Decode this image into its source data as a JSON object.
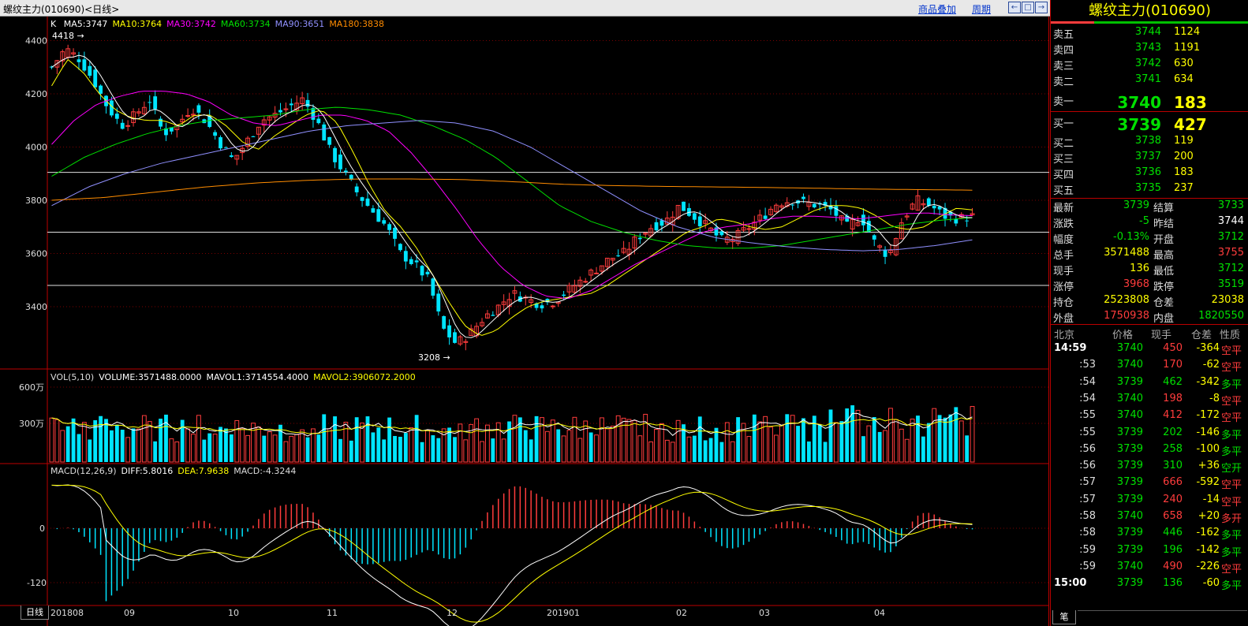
{
  "window": {
    "title": "螺纹主力(010690)<日线>",
    "link_overlay": "商品叠加",
    "link_period": "周期",
    "btn_prev_icon": "arrow-left-icon",
    "btn_restore_icon": "window-restore-icon",
    "btn_next_icon": "arrow-right-icon"
  },
  "main_chart": {
    "label": "K",
    "ma_legend": [
      {
        "text": "MA5:3747",
        "color": "#ffffff"
      },
      {
        "text": "MA10:3764",
        "color": "#ffff00"
      },
      {
        "text": "MA30:3742",
        "color": "#ff00ff"
      },
      {
        "text": "MA60:3734",
        "color": "#00e000"
      },
      {
        "text": "MA90:3651",
        "color": "#9090ff"
      },
      {
        "text": "MA180:3838",
        "color": "#ff8c00"
      }
    ],
    "y_ticks": [
      "4400",
      "4200",
      "4000",
      "3800",
      "3600",
      "3400"
    ],
    "high_marker": "4418",
    "low_marker": "3208"
  },
  "volume_chart": {
    "legend": [
      {
        "text": "VOL(5,10)",
        "color": "#dddddd"
      },
      {
        "text": "VOLUME:3571488.0000",
        "color": "#ffffff"
      },
      {
        "text": "MAVOL1:3714554.4000",
        "color": "#ffffff"
      },
      {
        "text": "MAVOL2:3906072.2000",
        "color": "#ffff00"
      }
    ],
    "y_ticks": [
      "600万",
      "300万"
    ]
  },
  "macd_chart": {
    "legend": [
      {
        "text": "MACD(12,26,9)",
        "color": "#dddddd"
      },
      {
        "text": "DIFF:5.8016",
        "color": "#ffffff"
      },
      {
        "text": "DEA:7.9638",
        "color": "#ffff00"
      },
      {
        "text": "MACD:-4.3244",
        "color": "#dddddd"
      }
    ],
    "y_ticks": [
      "0",
      "-120"
    ]
  },
  "x_axis": {
    "tab": "日线",
    "labels": [
      "201808",
      "09",
      "10",
      "11",
      "12",
      "201901",
      "02",
      "03",
      "04"
    ]
  },
  "chart_data": {
    "type": "candlestick",
    "title": "螺纹主力(010690)<日线>",
    "x_labels": [
      "201808",
      "09",
      "10",
      "11",
      "12",
      "201901",
      "02",
      "03",
      "04"
    ],
    "ylim": [
      3200,
      4450
    ],
    "y_ticks": [
      4400,
      4200,
      4000,
      3800,
      3600,
      3400
    ],
    "period_high": 4418,
    "period_low": 3208,
    "close_path": [
      4300,
      4370,
      4330,
      4250,
      4150,
      4080,
      4120,
      4180,
      4050,
      4080,
      4150,
      4100,
      4020,
      3950,
      4020,
      4100,
      4120,
      4150,
      4180,
      4100,
      3980,
      3900,
      3820,
      3760,
      3700,
      3600,
      3560,
      3500,
      3320,
      3260,
      3300,
      3360,
      3400,
      3450,
      3430,
      3410,
      3420,
      3460,
      3500,
      3540,
      3580,
      3600,
      3660,
      3700,
      3720,
      3780,
      3740,
      3700,
      3650,
      3660,
      3700,
      3740,
      3790,
      3800,
      3790,
      3780,
      3760,
      3700,
      3740,
      3640,
      3590,
      3730,
      3800,
      3780,
      3740,
      3730,
      3739
    ],
    "series": [
      {
        "name": "MA5",
        "last": 3747
      },
      {
        "name": "MA10",
        "last": 3764
      },
      {
        "name": "MA30",
        "last": 3742
      },
      {
        "name": "MA60",
        "last": 3734
      },
      {
        "name": "MA90",
        "last": 3651
      },
      {
        "name": "MA180",
        "last": 3838
      }
    ],
    "ma_paths": {
      "MA10": [
        4230,
        4330,
        4280,
        4200,
        4140,
        4110,
        4100,
        4100,
        4080,
        4120,
        4120,
        4080,
        4020,
        3990,
        4040,
        4080,
        4120,
        4140,
        4090,
        3980,
        3860,
        3760,
        3700,
        3620,
        3520,
        3420,
        3330,
        3290,
        3310,
        3360,
        3400,
        3420,
        3430,
        3440,
        3450,
        3480,
        3520,
        3560,
        3600,
        3640,
        3680,
        3700,
        3730,
        3720,
        3700,
        3690,
        3700,
        3730,
        3760,
        3780,
        3780,
        3770,
        3740,
        3700,
        3690,
        3700,
        3740,
        3770,
        3764
      ],
      "MA30": [
        4010,
        4100,
        4160,
        4190,
        4210,
        4210,
        4200,
        4170,
        4120,
        4090,
        4080,
        4100,
        4120,
        4120,
        4100,
        4060,
        3980,
        3880,
        3770,
        3650,
        3550,
        3480,
        3440,
        3430,
        3460,
        3510,
        3560,
        3600,
        3640,
        3680,
        3700,
        3710,
        3730,
        3740,
        3740,
        3735,
        3730,
        3740,
        3750,
        3752,
        3745,
        3742
      ],
      "MA60": [
        3890,
        3960,
        4010,
        4050,
        4080,
        4100,
        4110,
        4120,
        4140,
        4150,
        4140,
        4120,
        4080,
        4030,
        3960,
        3870,
        3780,
        3720,
        3680,
        3650,
        3630,
        3620,
        3620,
        3630,
        3650,
        3670,
        3690,
        3710,
        3725,
        3734
      ],
      "MA90": [
        3780,
        3850,
        3900,
        3940,
        3970,
        4000,
        4030,
        4060,
        4080,
        4090,
        4100,
        4090,
        4060,
        4000,
        3920,
        3840,
        3760,
        3700,
        3660,
        3640,
        3625,
        3615,
        3610,
        3615,
        3630,
        3651
      ],
      "MA180": [
        3800,
        3810,
        3830,
        3850,
        3865,
        3875,
        3880,
        3880,
        3878,
        3870,
        3860,
        3855,
        3852,
        3850,
        3848,
        3845,
        3842,
        3840,
        3838
      ]
    },
    "volume": {
      "unit": "万",
      "y_ticks": [
        600,
        300
      ],
      "last": 3571488,
      "mavol1": 3714554.4,
      "mavol2": 3906072.2
    },
    "macd": {
      "y_ticks": [
        0,
        -120
      ],
      "diff": 5.8016,
      "dea": 7.9638,
      "macd": -4.3244
    }
  },
  "quote_panel": {
    "title": "螺纹主力(010690)",
    "asks": [
      {
        "label": "卖五",
        "price": "3744",
        "vol": "1124"
      },
      {
        "label": "卖四",
        "price": "3743",
        "vol": "1191"
      },
      {
        "label": "卖三",
        "price": "3742",
        "vol": "630"
      },
      {
        "label": "卖二",
        "price": "3741",
        "vol": "634"
      },
      {
        "label": "卖一",
        "price": "3740",
        "vol": "183"
      }
    ],
    "bids": [
      {
        "label": "买一",
        "price": "3739",
        "vol": "427"
      },
      {
        "label": "买二",
        "price": "3738",
        "vol": "119"
      },
      {
        "label": "买三",
        "price": "3737",
        "vol": "200"
      },
      {
        "label": "买四",
        "price": "3736",
        "vol": "183"
      },
      {
        "label": "买五",
        "price": "3735",
        "vol": "237"
      }
    ],
    "stats": [
      {
        "l1": "最新",
        "v1": "3739",
        "c1": "g",
        "l2": "结算",
        "v2": "3733",
        "c2": "g"
      },
      {
        "l1": "涨跌",
        "v1": "-5",
        "c1": "g",
        "l2": "昨结",
        "v2": "3744",
        "c2": "w"
      },
      {
        "l1": "幅度",
        "v1": "-0.13%",
        "c1": "g",
        "l2": "开盘",
        "v2": "3712",
        "c2": "g"
      },
      {
        "l1": "总手",
        "v1": "3571488",
        "c1": "y",
        "l2": "最高",
        "v2": "3755",
        "c2": "r"
      },
      {
        "l1": "现手",
        "v1": "136",
        "c1": "y",
        "l2": "最低",
        "v2": "3712",
        "c2": "g"
      },
      {
        "l1": "涨停",
        "v1": "3968",
        "c1": "r",
        "l2": "跌停",
        "v2": "3519",
        "c2": "g"
      },
      {
        "l1": "持仓",
        "v1": "2523808",
        "c1": "y",
        "l2": "仓差",
        "v2": "23038",
        "c2": "y"
      },
      {
        "l1": "外盘",
        "v1": "1750938",
        "c1": "r",
        "l2": "内盘",
        "v2": "1820550",
        "c2": "g"
      }
    ],
    "tick_header": [
      "北京",
      "价格",
      "现手",
      "仓差",
      "性质"
    ],
    "ticks": [
      {
        "t": "14:59",
        "p": "3740",
        "pc": "g",
        "v": "450",
        "vc": "r",
        "oi": "-364",
        "n": "空平",
        "nc": "r"
      },
      {
        "t": ":53",
        "p": "3740",
        "pc": "g",
        "v": "170",
        "vc": "r",
        "oi": "-62",
        "n": "空平",
        "nc": "r"
      },
      {
        "t": ":54",
        "p": "3739",
        "pc": "g",
        "v": "462",
        "vc": "g",
        "oi": "-342",
        "n": "多平",
        "nc": "g"
      },
      {
        "t": ":54",
        "p": "3740",
        "pc": "g",
        "v": "198",
        "vc": "r",
        "oi": "-8",
        "n": "空平",
        "nc": "r"
      },
      {
        "t": ":55",
        "p": "3740",
        "pc": "g",
        "v": "412",
        "vc": "r",
        "oi": "-172",
        "n": "空平",
        "nc": "r"
      },
      {
        "t": ":55",
        "p": "3739",
        "pc": "g",
        "v": "202",
        "vc": "g",
        "oi": "-146",
        "n": "多平",
        "nc": "g"
      },
      {
        "t": ":56",
        "p": "3739",
        "pc": "g",
        "v": "258",
        "vc": "g",
        "oi": "-100",
        "n": "多平",
        "nc": "g"
      },
      {
        "t": ":56",
        "p": "3739",
        "pc": "g",
        "v": "310",
        "vc": "g",
        "oi": "+36",
        "n": "空开",
        "nc": "g"
      },
      {
        "t": ":57",
        "p": "3739",
        "pc": "g",
        "v": "666",
        "vc": "r",
        "oi": "-592",
        "n": "空平",
        "nc": "r"
      },
      {
        "t": ":57",
        "p": "3739",
        "pc": "g",
        "v": "240",
        "vc": "r",
        "oi": "-14",
        "n": "空平",
        "nc": "r"
      },
      {
        "t": ":58",
        "p": "3740",
        "pc": "g",
        "v": "658",
        "vc": "r",
        "oi": "+20",
        "n": "多开",
        "nc": "r"
      },
      {
        "t": ":58",
        "p": "3739",
        "pc": "g",
        "v": "446",
        "vc": "g",
        "oi": "-162",
        "n": "多平",
        "nc": "g"
      },
      {
        "t": ":59",
        "p": "3739",
        "pc": "g",
        "v": "196",
        "vc": "g",
        "oi": "-142",
        "n": "多平",
        "nc": "g"
      },
      {
        "t": ":59",
        "p": "3740",
        "pc": "g",
        "v": "490",
        "vc": "r",
        "oi": "-226",
        "n": "空平",
        "nc": "r"
      },
      {
        "t": "15:00",
        "p": "3739",
        "pc": "g",
        "v": "136",
        "vc": "g",
        "oi": "-60",
        "n": "多平",
        "nc": "g"
      }
    ],
    "bottom_tab": "笔"
  }
}
